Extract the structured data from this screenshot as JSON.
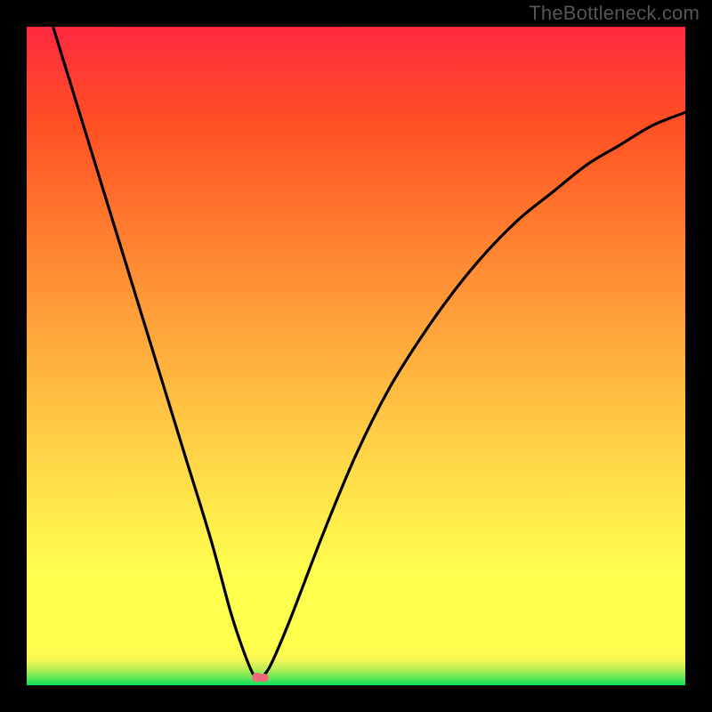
{
  "watermark": "TheBottleneck.com",
  "colors": {
    "frame": "#000000",
    "watermark": "#555555",
    "curve": "#000000",
    "marker": "#ef6b77"
  },
  "plot": {
    "inner_w": 740,
    "inner_h": 740,
    "margin": 30
  },
  "chart_data": {
    "type": "line",
    "title": "",
    "xlabel": "",
    "ylabel": "",
    "xlim": [
      0,
      100
    ],
    "ylim": [
      0,
      100
    ],
    "series": [
      {
        "name": "bottleneck-curve",
        "x": [
          4,
          8,
          12,
          16,
          20,
          24,
          28,
          31,
          33,
          34.5,
          35.5,
          37,
          40,
          45,
          50,
          55,
          60,
          65,
          70,
          75,
          80,
          85,
          90,
          95,
          100
        ],
        "y": [
          100,
          87,
          74,
          61,
          48,
          35,
          22,
          11,
          5,
          1.5,
          1.2,
          3,
          10,
          23,
          35,
          45,
          53,
          60,
          66,
          71,
          75,
          79,
          82,
          85,
          87
        ]
      }
    ],
    "marker": {
      "x": 35.2,
      "y": 1.2
    },
    "annotations": []
  }
}
